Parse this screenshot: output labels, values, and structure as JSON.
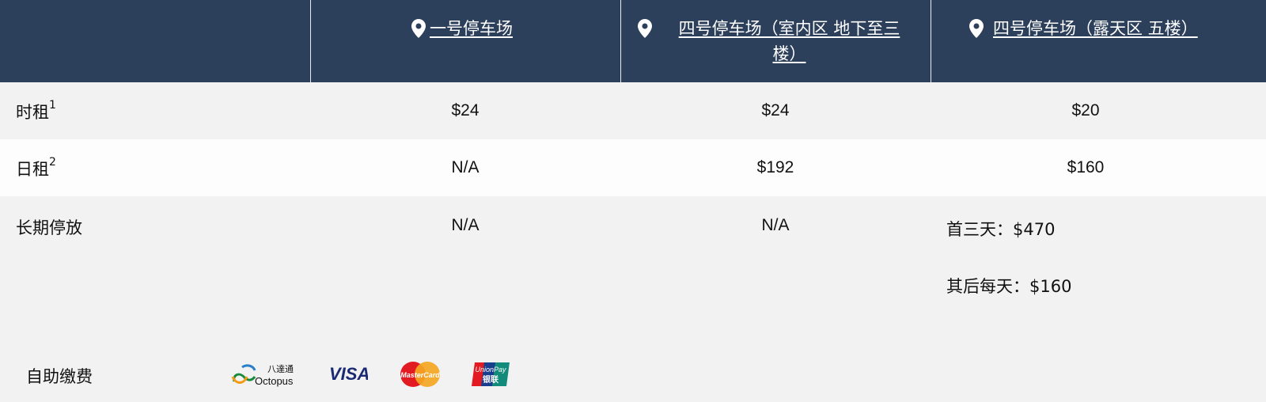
{
  "header": {
    "columns": [
      {
        "name": "一号停车场",
        "icon": "map-pin-icon"
      },
      {
        "name": "四号停车场（室内区 地下至三楼）",
        "icon": "map-pin-icon"
      },
      {
        "name": "四号停车场（露天区 五楼）",
        "icon": "map-pin-icon"
      }
    ]
  },
  "rows": [
    {
      "label": "时租",
      "footnote": "1",
      "values": [
        "$24",
        "$24",
        "$20"
      ]
    },
    {
      "label": "日租",
      "footnote": "2",
      "values": [
        "N/A",
        "$192",
        "$160"
      ]
    },
    {
      "label": "长期停放",
      "values": [
        "N/A",
        "N/A"
      ],
      "lines": [
        "首三天：$470",
        "其后每天：$160"
      ]
    }
  ],
  "payment": {
    "label": "自助缴费",
    "logos": [
      "octopus-logo",
      "visa-logo",
      "mastercard-logo",
      "unionpay-logo"
    ],
    "octopus_text_cn": "八達通",
    "octopus_text_en": "Octopus",
    "visa_text": "VISA",
    "mastercard_text": "MasterCard",
    "unionpay_text_en": "UnionPay",
    "unionpay_text_cn": "银联"
  },
  "colors": {
    "header_bg": "#2c3f5b",
    "row_alt": "#fdfdfd",
    "row": "#f2f2f2"
  }
}
